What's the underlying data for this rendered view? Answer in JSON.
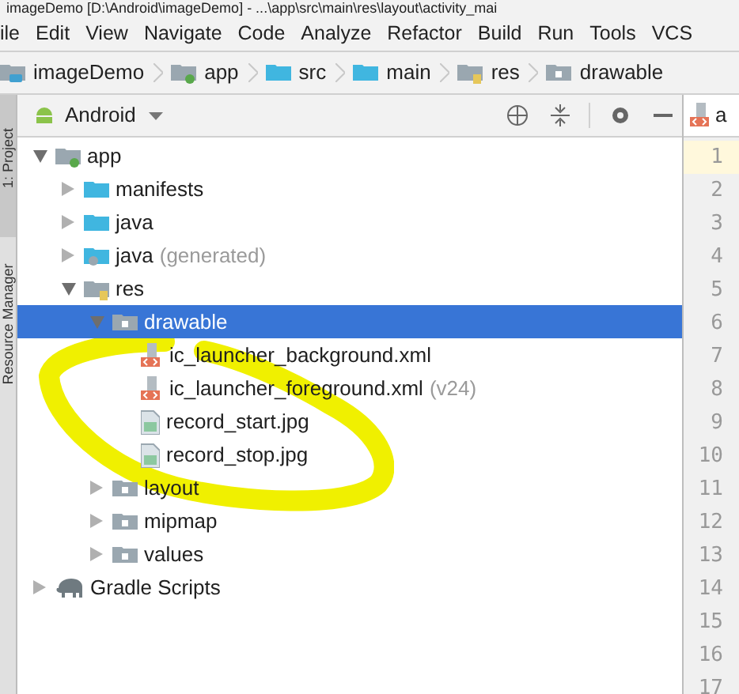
{
  "window": {
    "title": "imageDemo [D:\\Android\\imageDemo] - ...\\app\\src\\main\\res\\layout\\activity_mai"
  },
  "menu": [
    "ile",
    "Edit",
    "View",
    "Navigate",
    "Code",
    "Analyze",
    "Refactor",
    "Build",
    "Run",
    "Tools",
    "VCS"
  ],
  "breadcrumb": [
    {
      "label": "imageDemo",
      "kind": "project"
    },
    {
      "label": "app",
      "kind": "module"
    },
    {
      "label": "src",
      "kind": "folder"
    },
    {
      "label": "main",
      "kind": "folder"
    },
    {
      "label": "res",
      "kind": "res"
    },
    {
      "label": "drawable",
      "kind": "resdir"
    }
  ],
  "side_tabs": [
    "1: Project",
    "Resource Manager"
  ],
  "project_panel": {
    "view": "Android",
    "tree": [
      {
        "label": "app",
        "kind": "module",
        "expanded": true,
        "selected": false,
        "children": [
          {
            "label": "manifests",
            "kind": "folder",
            "expanded": false,
            "selected": false
          },
          {
            "label": "java",
            "kind": "folder",
            "expanded": false,
            "selected": false
          },
          {
            "label": "java",
            "suffix": "(generated)",
            "kind": "gen",
            "expanded": false,
            "selected": false
          },
          {
            "label": "res",
            "kind": "res",
            "expanded": true,
            "selected": false,
            "children": [
              {
                "label": "drawable",
                "kind": "resdir",
                "expanded": true,
                "selected": true,
                "children": [
                  {
                    "label": "ic_launcher_background.xml",
                    "kind": "xml",
                    "selected": false
                  },
                  {
                    "label": "ic_launcher_foreground.xml",
                    "suffix": "(v24)",
                    "kind": "xml",
                    "selected": false
                  },
                  {
                    "label": "record_start.jpg",
                    "kind": "image",
                    "selected": false
                  },
                  {
                    "label": "record_stop.jpg",
                    "kind": "image",
                    "selected": false
                  }
                ]
              },
              {
                "label": "layout",
                "kind": "resdir",
                "expanded": false,
                "selected": false
              },
              {
                "label": "mipmap",
                "kind": "resdir",
                "expanded": false,
                "selected": false
              },
              {
                "label": "values",
                "kind": "resdir",
                "expanded": false,
                "selected": false
              }
            ]
          }
        ]
      },
      {
        "label": "Gradle Scripts",
        "kind": "gradle",
        "expanded": false,
        "selected": false
      }
    ]
  },
  "editor": {
    "tab": "a",
    "line_numbers": [
      "1",
      "2",
      "3",
      "4",
      "5",
      "6",
      "7",
      "8",
      "9",
      "10",
      "11",
      "12",
      "13",
      "14",
      "15",
      "16",
      "17"
    ]
  }
}
